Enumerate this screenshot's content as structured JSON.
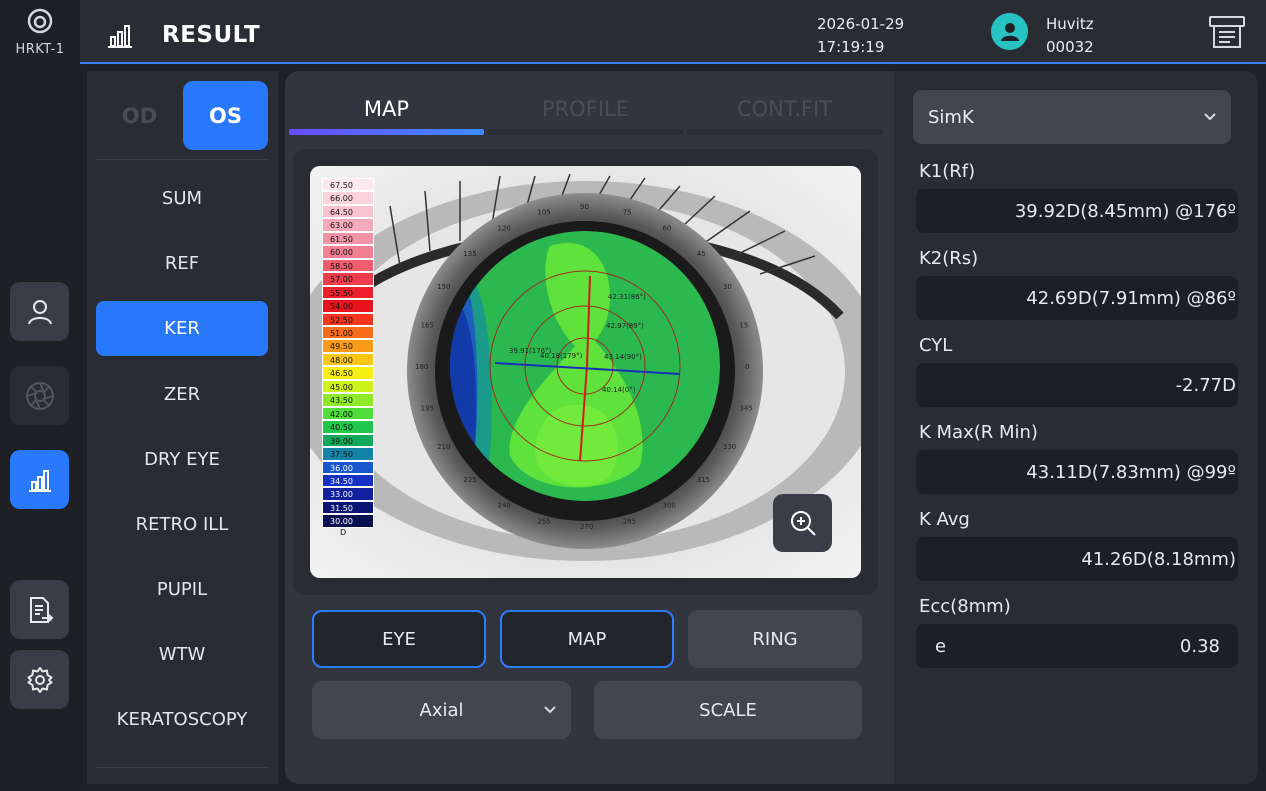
{
  "brand": {
    "name": "HRKT-1"
  },
  "header": {
    "title": "RESULT",
    "date": "2026-01-29",
    "time": "17:19:19",
    "user_name": "Huvitz",
    "user_id": "00032"
  },
  "rail": {
    "items": [
      {
        "name": "patient",
        "icon": "user-icon"
      },
      {
        "name": "camera",
        "icon": "aperture-icon"
      },
      {
        "name": "result",
        "icon": "bar-chart-icon",
        "active": true
      },
      {
        "name": "report",
        "icon": "document-export-icon"
      },
      {
        "name": "settings",
        "icon": "gear-icon"
      }
    ]
  },
  "eye": {
    "od": "OD",
    "os": "OS",
    "selected": "OS"
  },
  "subnav": {
    "items": [
      "SUM",
      "REF",
      "KER",
      "ZER",
      "DRY EYE",
      "RETRO ILL",
      "PUPIL",
      "WTW",
      "KERATOSCOPY"
    ],
    "active": "KER"
  },
  "tabs": {
    "map": "MAP",
    "profile": "PROFILE",
    "contfit": "CONT.FIT"
  },
  "scale": {
    "values": [
      "67.50",
      "66.00",
      "64.50",
      "63.00",
      "61.50",
      "60.00",
      "58.50",
      "57.00",
      "55.50",
      "54.00",
      "52.50",
      "51.00",
      "49.50",
      "48.00",
      "46.50",
      "45.00",
      "43.50",
      "42.00",
      "40.50",
      "39.00",
      "37.50",
      "36.00",
      "34.50",
      "33.00",
      "31.50",
      "30.00"
    ],
    "colors": [
      "#fde8ee",
      "#fcd4dd",
      "#f9c2cf",
      "#f6a9b9",
      "#f393a6",
      "#f27f93",
      "#ef5d6f",
      "#ee3c4c",
      "#ee1f2b",
      "#e8131d",
      "#f5361e",
      "#f86b1a",
      "#fb9a16",
      "#fdc514",
      "#f6ee14",
      "#cdf11b",
      "#8fea2a",
      "#50dd3a",
      "#21c74a",
      "#12a95a",
      "#1384a6",
      "#1a56cc",
      "#1530c4",
      "#10209f",
      "#0c1573",
      "#09104f"
    ],
    "unit": "D"
  },
  "map_labels": {
    "angles": [
      "105",
      "90",
      "75",
      "60",
      "45",
      "30",
      "15",
      "0",
      "345",
      "330",
      "315",
      "300",
      "285",
      "270",
      "255",
      "240",
      "225",
      "210",
      "195",
      "180",
      "165",
      "150",
      "135",
      "120"
    ],
    "k_readings": [
      "42.31(86°)",
      "42.97(89°)",
      "39.91(176°)",
      "40.18(179°)",
      "43.14(90°)",
      "40.14(0°)"
    ]
  },
  "controls": {
    "eye_btn": "EYE",
    "map_btn": "MAP",
    "ring_btn": "RING",
    "map_type": "Axial",
    "scale_btn": "SCALE"
  },
  "results": {
    "mode": "SimK",
    "k1_label": "K1(Rf)",
    "k1_value": "39.92D(8.45mm) @176º",
    "k2_label": "K2(Rs)",
    "k2_value": "42.69D(7.91mm) @86º",
    "cyl_label": "CYL",
    "cyl_value": "-2.77D",
    "kmax_label": "K Max(R Min)",
    "kmax_value": "43.11D(7.83mm) @99º",
    "kavg_label": "K Avg",
    "kavg_value": "41.26D(8.18mm)",
    "ecc_label": "Ecc(8mm)",
    "ecc_symbol": "e",
    "ecc_value": "0.38"
  },
  "colors": {
    "accent": "#2979ff",
    "panel": "#2a2c33",
    "bg": "#1f2127"
  }
}
